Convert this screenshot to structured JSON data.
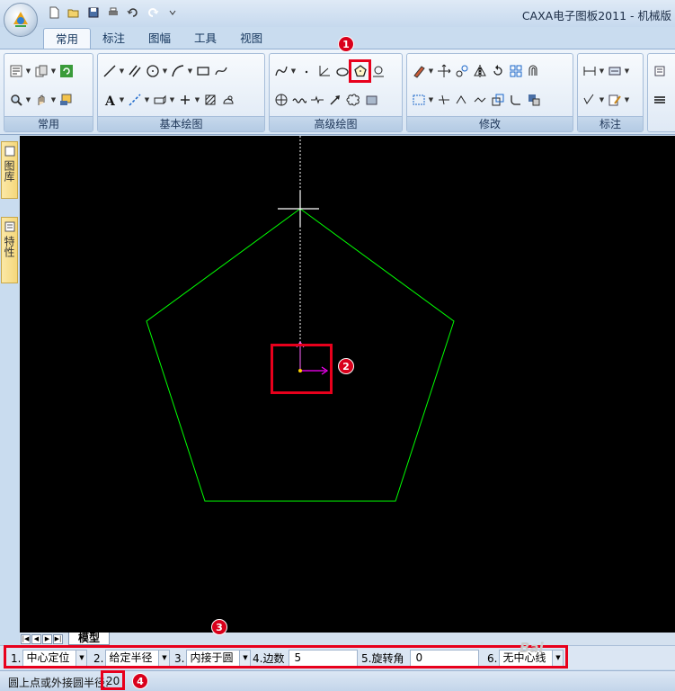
{
  "window": {
    "title": "CAXA电子图板2011 - 机械版"
  },
  "tabs": [
    "常用",
    "标注",
    "图幅",
    "工具",
    "视图"
  ],
  "ribbon_groups": [
    "常用",
    "基本绘图",
    "高级绘图",
    "修改",
    "标注"
  ],
  "markers": [
    "1",
    "2",
    "3",
    "4"
  ],
  "side_panels": [
    "图库",
    "特性"
  ],
  "sheet_tab": "模型",
  "props": {
    "p1_label": "1.",
    "p1_value": "中心定位",
    "p2_label": "2.",
    "p2_value": "给定半径",
    "p3_label": "3.",
    "p3_value": "内接于圆",
    "p4_label": "4.边数",
    "p4_value": "5",
    "p5_label": "5.旋转角",
    "p5_value": "0",
    "p6_label": "6.",
    "p6_value": "无中心线"
  },
  "status": {
    "prompt": "圆上点或外接圆半径:",
    "input": "20"
  },
  "watermark": "Bai",
  "colors": {
    "canvas": "#000000",
    "polygon": "#00ff00",
    "highlight": "#e8001c",
    "axis_magenta": "#ff00ff"
  }
}
